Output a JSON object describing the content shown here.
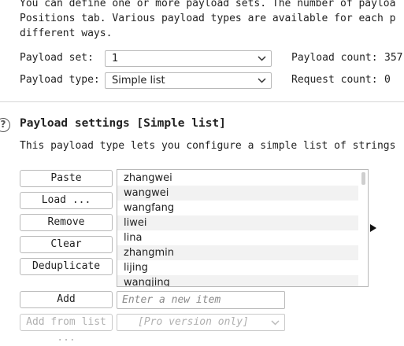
{
  "intro": {
    "line1": "You can define one or more payload sets. The number of payloa",
    "line2": "Positions tab. Various payload types are available for each p",
    "line3": "different ways."
  },
  "payload_set": {
    "label": "Payload set:",
    "value": "1",
    "count_label": "Payload count:",
    "count_value": "357"
  },
  "payload_type": {
    "label": "Payload type:",
    "value": "Simple list",
    "request_label": "Request count:",
    "request_value": "0"
  },
  "settings": {
    "help_icon_glyph": "?",
    "title": "Payload settings [Simple list]",
    "description": "This payload type lets you configure a simple list of strings"
  },
  "buttons": {
    "paste": "Paste",
    "load": "Load ...",
    "remove": "Remove",
    "clear": "Clear",
    "deduplicate": "Deduplicate",
    "add": "Add",
    "add_from_list": "Add from list ..."
  },
  "list_items": [
    "zhangwei",
    "wangwei",
    "wangfang",
    "liwei",
    "lina",
    "zhangmin",
    "lijing",
    "wangjing"
  ],
  "add_item": {
    "placeholder": "Enter a new item"
  },
  "add_from_list_select": {
    "value": "[Pro version only]"
  },
  "icons": {
    "select_chevron": "chevron-down-icon",
    "expand_arrow": "triangle-right-icon",
    "help": "help-circle-icon"
  }
}
